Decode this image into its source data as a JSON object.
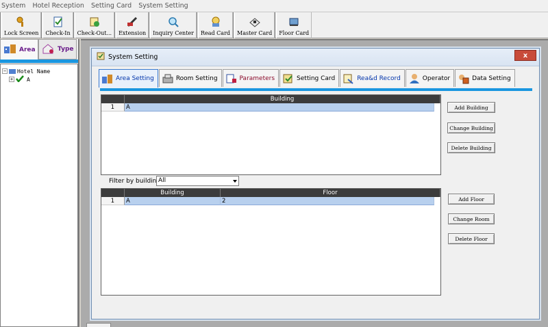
{
  "menu": [
    "System",
    "Hotel Reception",
    "Setting Card",
    "System Setting"
  ],
  "toolbar": [
    {
      "label": "Lock Screen",
      "icon": "key-icon"
    },
    {
      "label": "Check-In",
      "icon": "checkin-icon"
    },
    {
      "label": "Check-Out...",
      "icon": "checkout-icon"
    },
    {
      "label": "Extension",
      "icon": "extension-icon"
    },
    {
      "label": "Inquiry Center",
      "icon": "magnifier-icon"
    },
    {
      "label": "Read Card",
      "icon": "read-card-icon"
    },
    {
      "label": "Master Card",
      "icon": "master-card-icon"
    },
    {
      "label": "Floor Card",
      "icon": "floor-card-icon"
    }
  ],
  "left_panel": {
    "tabs": [
      "Area",
      "Type"
    ],
    "tree": {
      "root": "Hotel Name",
      "child": "A"
    }
  },
  "dialog": {
    "title": "System Setting",
    "close": "x",
    "tabs": [
      "Area Setting",
      "Room Setting",
      "Parameters",
      "Setting Card",
      "Rea&d Record",
      "Operator",
      "Data Setting"
    ],
    "buildings_grid": {
      "headers": [
        "Building"
      ],
      "rows": [
        {
          "num": "1",
          "building": "A"
        }
      ]
    },
    "building_buttons": [
      "Add Building",
      "Change Building",
      "Delete Building"
    ],
    "filter": {
      "label": "Filter by building:",
      "value": "All"
    },
    "floors_grid": {
      "headers": [
        "Building",
        "Floor"
      ],
      "rows": [
        {
          "num": "1",
          "building": "A",
          "floor": "2"
        }
      ]
    },
    "floor_buttons": [
      "Add Floor",
      "Change Room",
      "Delete Floor"
    ]
  }
}
